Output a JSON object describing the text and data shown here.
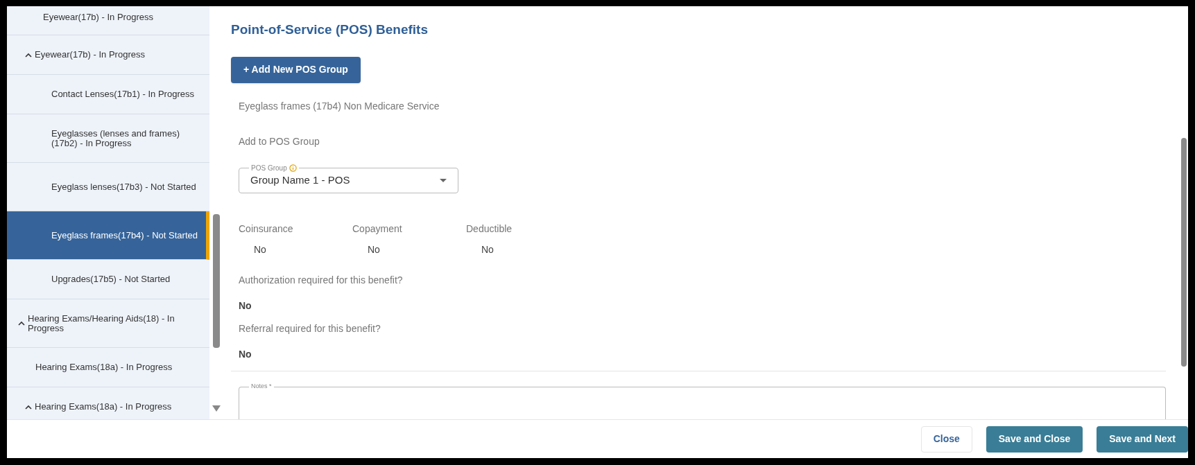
{
  "sidebar": {
    "items": [
      {
        "label": "Eyewear(17b) - In Progress",
        "selected": false
      },
      {
        "label": "Eyewear(17b) - In Progress",
        "selected": false,
        "expanded": true,
        "children": [
          {
            "label": "Contact Lenses(17b1) - In Progress",
            "selected": false
          },
          {
            "label": "Eyeglasses (lenses and frames) (17b2) - In Progress",
            "selected": false
          },
          {
            "label": "Eyeglass lenses(17b3) - Not Started",
            "selected": false
          },
          {
            "label": "Eyeglass frames(17b4) - Not Started",
            "selected": true
          },
          {
            "label": "Upgrades(17b5) - Not Started",
            "selected": false
          }
        ]
      },
      {
        "label": "Hearing Exams/Hearing Aids(18) - In Progress",
        "selected": false,
        "expanded": true,
        "children": [
          {
            "label": "Hearing Exams(18a) - In Progress",
            "selected": false
          }
        ]
      },
      {
        "label": "Hearing Exams(18a) - In Progress",
        "selected": false,
        "expanded": true
      }
    ]
  },
  "content": {
    "title": "Point-of-Service (POS) Benefits",
    "add_button": "+ Add New POS Group",
    "service_name": "Eyeglass frames (17b4) Non Medicare Service",
    "group_heading": "Add to POS Group",
    "pos_group": {
      "label": "POS Group",
      "value": "Group Name 1 - POS"
    },
    "cost_sharing": [
      {
        "label": "Coinsurance",
        "value": "No"
      },
      {
        "label": "Copayment",
        "value": "No"
      },
      {
        "label": "Deductible",
        "value": "No"
      }
    ],
    "questions": [
      {
        "label": "Authorization required for this benefit?",
        "value": "No"
      },
      {
        "label": "Referral required for this benefit?",
        "value": "No"
      }
    ],
    "notes": {
      "label": "Notes *"
    }
  },
  "footer": {
    "buttons": [
      {
        "label": "Close",
        "kind": "secondary"
      },
      {
        "label": "Save and Close",
        "kind": "primary"
      },
      {
        "label": "Save and Next",
        "kind": "primary"
      }
    ]
  }
}
